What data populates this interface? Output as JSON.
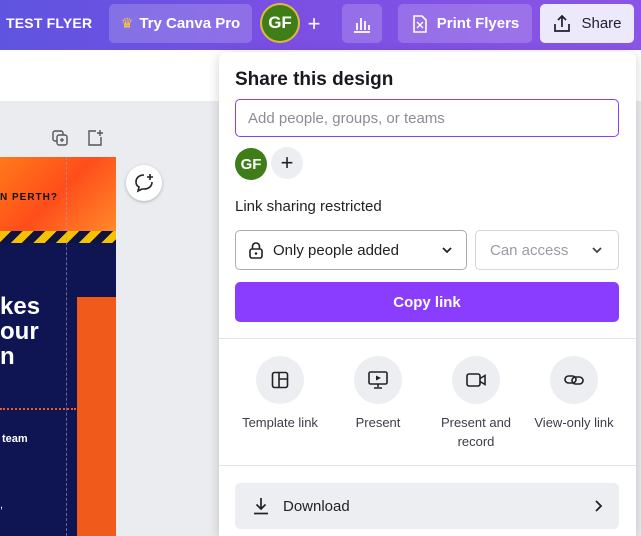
{
  "header": {
    "project_name": "TEST FLYER",
    "try_pro_label": "Try Canva Pro",
    "avatar_initials": "GF",
    "print_label": "Print Flyers",
    "share_label": "Share"
  },
  "flyer_preview": {
    "text_perth": "N PERTH?",
    "big_lines": [
      "kes",
      "our",
      "n"
    ],
    "team_text": "team",
    "comma_text": ","
  },
  "share_panel": {
    "title": "Share this design",
    "people_input_placeholder": "Add people, groups, or teams",
    "collaborator_initials": "GF",
    "link_sharing_label": "Link sharing restricted",
    "access_selected": "Only people added",
    "permission_selected": "Can access",
    "copy_link_label": "Copy link",
    "options": [
      {
        "label": "Template link",
        "icon": "template-icon"
      },
      {
        "label": "Present",
        "icon": "present-icon"
      },
      {
        "label": "Present and record",
        "icon": "record-icon"
      },
      {
        "label": "View-only link",
        "icon": "link-icon"
      }
    ],
    "download_label": "Download"
  },
  "colors": {
    "accent": "#8b3dff",
    "avatar": "#3e7d17",
    "topbar_start": "#5e54e0",
    "topbar_end": "#8a55e6"
  }
}
